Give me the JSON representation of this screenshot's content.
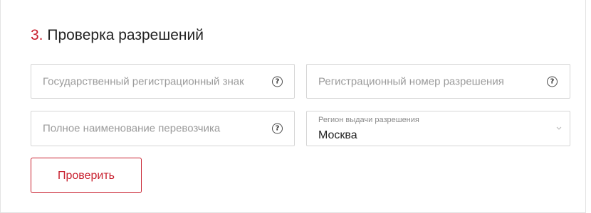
{
  "section": {
    "number": "3.",
    "title": "Проверка разрешений"
  },
  "fields": {
    "reg_sign": {
      "placeholder": "Государственный регистрационный знак",
      "help": "?"
    },
    "permit_number": {
      "placeholder": "Регистрационный номер разрешения",
      "help": "?"
    },
    "carrier_name": {
      "placeholder": "Полное наименование перевозчика",
      "help": "?"
    },
    "region": {
      "label": "Регион выдачи разрешения",
      "value": "Москва",
      "icon": "chevron-down-icon"
    }
  },
  "actions": {
    "check_label": "Проверить"
  },
  "colors": {
    "accent": "#c8202e",
    "border": "#d6d6d6",
    "placeholder": "#9a9a9a",
    "text": "#222222"
  }
}
